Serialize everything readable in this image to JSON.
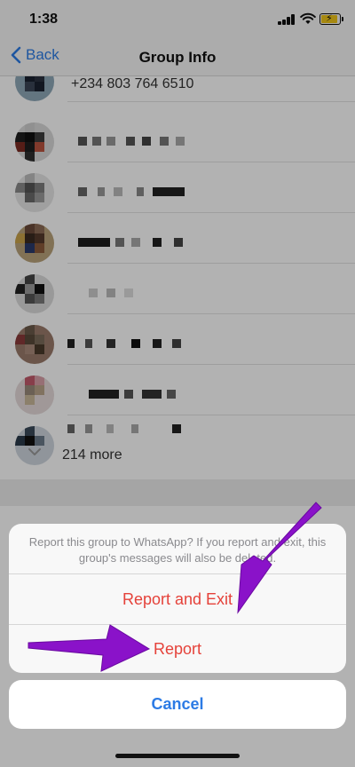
{
  "status_bar": {
    "time": "1:38"
  },
  "nav": {
    "back_label": "Back",
    "title": "Group Info"
  },
  "member_list": {
    "partial_number": "+234 803 764 6510",
    "more_label": "214 more"
  },
  "action_sheet": {
    "message": "Report this group to WhatsApp? If you report and exit, this group's messages will also be deleted.",
    "report_exit_label": "Report and Exit",
    "report_label": "Report",
    "cancel_label": "Cancel"
  },
  "colors": {
    "ios_blue": "#2c7be5",
    "destructive_red": "#e5423a",
    "annotation_purple": "#8a12c9"
  },
  "icons": [
    "back-chevron-icon",
    "chevron-down-icon",
    "signal-icon",
    "wifi-icon",
    "battery-icon"
  ]
}
